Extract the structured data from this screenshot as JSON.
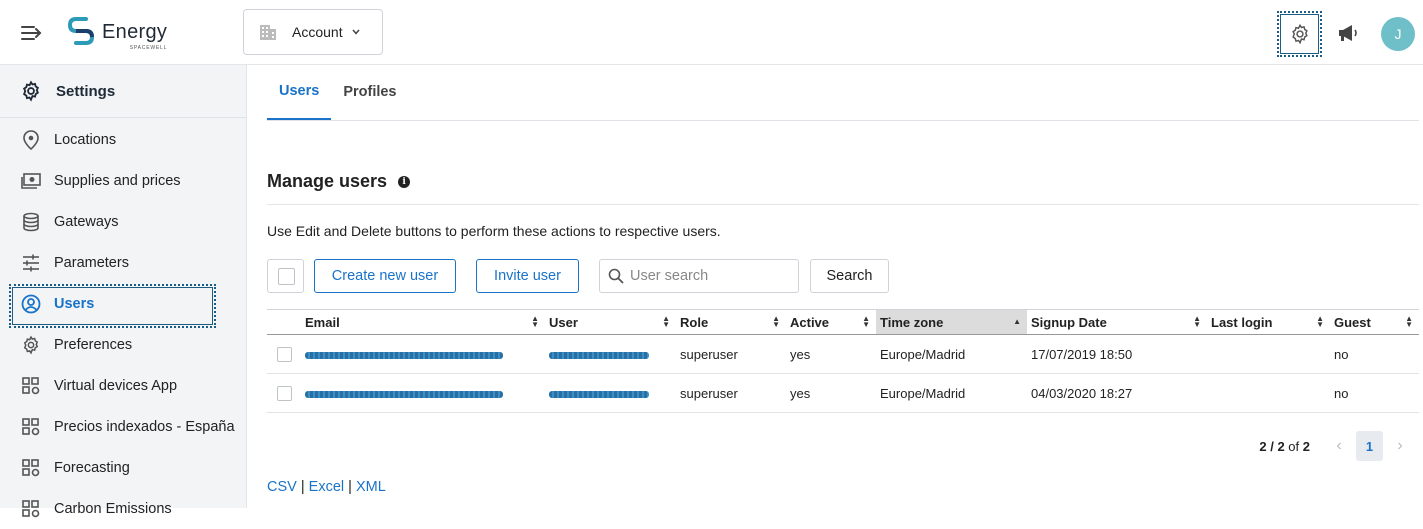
{
  "app": {
    "brand": "Energy",
    "brand_sub": "SPACEWELL",
    "account_label": "Account",
    "avatar_initial": "J"
  },
  "sidebar": {
    "title": "Settings",
    "items": [
      {
        "label": "Locations",
        "icon": "location-pin-icon"
      },
      {
        "label": "Supplies and prices",
        "icon": "money-icon"
      },
      {
        "label": "Gateways",
        "icon": "database-icon"
      },
      {
        "label": "Parameters",
        "icon": "sliders-icon"
      },
      {
        "label": "Users",
        "icon": "user-circle-icon",
        "active": true
      },
      {
        "label": "Preferences",
        "icon": "gear-icon"
      },
      {
        "label": "Virtual devices App",
        "icon": "app-grid-gear-icon"
      },
      {
        "label": "Precios indexados - España",
        "icon": "app-grid-gear-icon"
      },
      {
        "label": "Forecasting",
        "icon": "app-grid-gear-icon"
      },
      {
        "label": "Carbon Emissions",
        "icon": "app-grid-gear-icon"
      }
    ]
  },
  "tabs": [
    {
      "label": "Users",
      "active": true
    },
    {
      "label": "Profiles",
      "active": false
    }
  ],
  "manage": {
    "title": "Manage users",
    "description": "Use Edit and Delete buttons to perform these actions to respective users.",
    "create_label": "Create new user",
    "invite_label": "Invite user",
    "search_placeholder": "User search",
    "search_label": "Search"
  },
  "table": {
    "columns": [
      "Email",
      "User",
      "Role",
      "Active",
      "Time zone",
      "Signup Date",
      "Last login",
      "Guest"
    ],
    "sorted_column": "Time zone",
    "rows": [
      {
        "email": "",
        "user": "",
        "role": "superuser",
        "active": "yes",
        "timezone": "Europe/Madrid",
        "signup": "17/07/2019 18:50",
        "last_login": "",
        "guest": "no"
      },
      {
        "email": "",
        "user": "",
        "role": "superuser",
        "active": "yes",
        "timezone": "Europe/Madrid",
        "signup": "04/03/2020 18:27",
        "last_login": "",
        "guest": "no"
      }
    ]
  },
  "pager": {
    "range": "2 / 2",
    "of_label": "of",
    "total": "2",
    "current_page": "1"
  },
  "exports": {
    "csv": "CSV",
    "excel": "Excel",
    "xml": "XML",
    "separator": "|"
  },
  "colors": {
    "accent": "#1a73c8",
    "sidebar_bg": "#f2f4f6",
    "avatar_bg": "#6fbfc9",
    "highlight_border": "#1c5d86"
  }
}
